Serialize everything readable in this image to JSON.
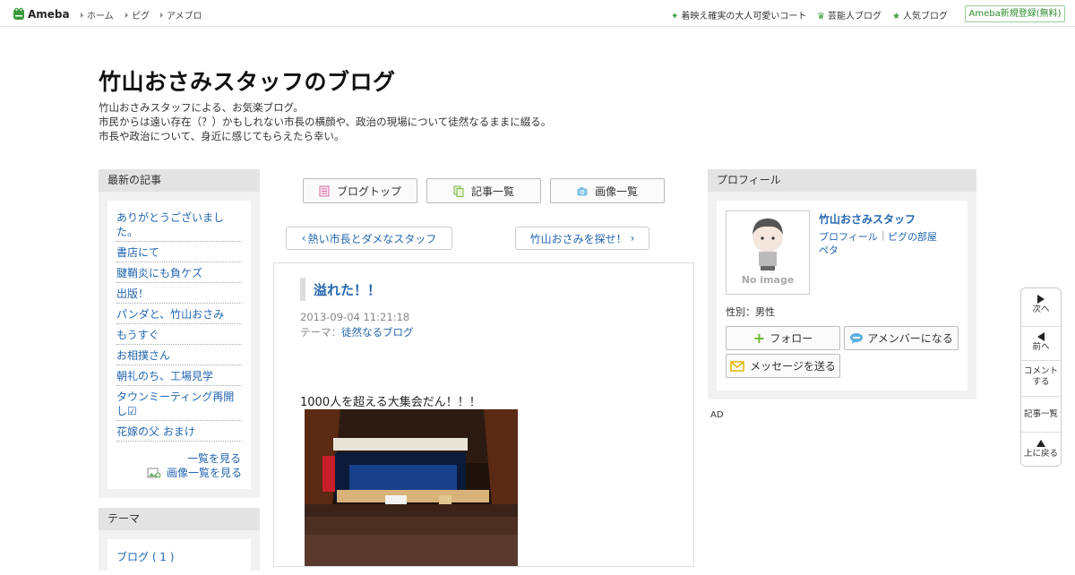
{
  "header": {
    "logo_text": "Ameba",
    "nav": [
      "ホーム",
      "ピグ",
      "アメブロ"
    ],
    "right_links": [
      "着映え確実の大人可愛いコート",
      "芸能人ブログ",
      "人気ブログ"
    ],
    "register_label": "Ameba新規登録(無料)"
  },
  "blog": {
    "title": "竹山おさみスタッフのブログ",
    "description": [
      "竹山おさみスタッフによる、お気楽ブログ。",
      "市民からは遠い存在（？）かもしれない市長の横顔や、政治の現場について徒然なるままに綴る。",
      "市長や政治について、身近に感じてもらえたら幸い。"
    ]
  },
  "left_sidebar": {
    "recent_heading": "最新の記事",
    "recent_articles": [
      "ありがとうございました。",
      "書店にて",
      "腱鞘炎にも負ケズ",
      "出版！",
      "パンダと、竹山おさみ",
      "もうすぐ",
      "お相撲さん",
      "朝礼のち、工場見学",
      "タウンミーティング再開し☑",
      "花嫁の父 おまけ"
    ],
    "see_list": "一覧を見る",
    "see_images": "画像一覧を見る",
    "theme_heading": "テーマ",
    "theme_items": [
      "ブログ ( 1 )"
    ]
  },
  "main": {
    "top_buttons": [
      "ブログトップ",
      "記事一覧",
      "画像一覧"
    ],
    "prev_entry": "熱い市長とダメなスタッフ",
    "next_entry": "竹山おさみを探せ！",
    "entry": {
      "title": "溢れた！！",
      "datetime": "2013-09-04 11:21:18",
      "theme_label": "テーマ：",
      "theme_name": "徒然なるブログ",
      "body_text": "1000人を超える大集会だん！！！"
    }
  },
  "profile": {
    "heading": "プロフィール",
    "noimage_text": "No image",
    "name": "竹山おさみスタッフ",
    "links": [
      "プロフィール",
      "ピグの部屋",
      "ペタ"
    ],
    "gender": "性別：男性",
    "buttons": {
      "follow": "フォロー",
      "amember": "アメンバーになる",
      "message": "メッセージを送る"
    },
    "ad_label": "AD"
  },
  "right_nav": {
    "next": "次へ",
    "prev": "前へ",
    "comment": "コメントする",
    "entry_list": "記事一覧",
    "back_top": "上に戻る"
  },
  "colors": {
    "link": "#2366b0",
    "brand_green": "#3a9a3a",
    "sidebar_head": "#e3e3e3"
  }
}
